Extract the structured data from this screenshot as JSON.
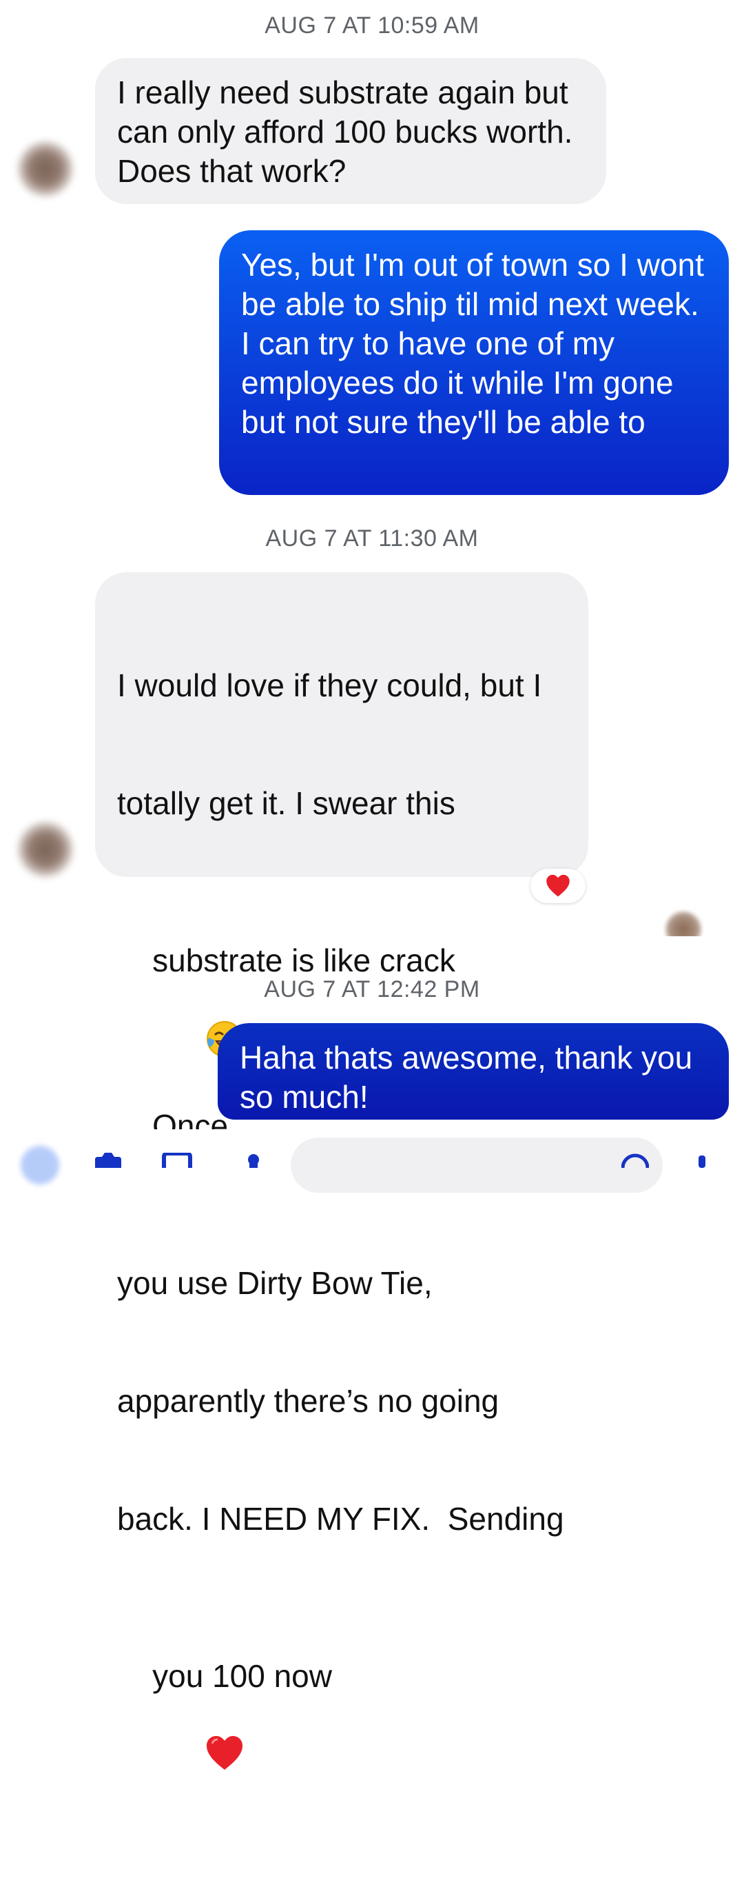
{
  "conversation": {
    "messages": [
      {
        "type": "timestamp",
        "text": "AUG 7 AT 10:59 AM"
      },
      {
        "type": "received",
        "text": "I really need substrate again but can only afford 100 bucks worth. Does that work?"
      },
      {
        "type": "sent",
        "text": "Yes, but I'm out of town so I wont be able to ship til mid next week. I can try to have one of my employees do it while I'm gone but not sure they'll be able to"
      },
      {
        "type": "timestamp",
        "text": "AUG 7 AT 11:30 AM"
      },
      {
        "type": "received",
        "lines": [
          "I would love if they could, but I",
          "totally get it. I swear this",
          "substrate is like crack",
          "Once",
          "you use Dirty Bow Tie,",
          "apparently there’s no going",
          "back. I NEED MY FIX.  Sending",
          "you 100 now"
        ],
        "emojis": [
          "face-with-tears-of-joy",
          "red-heart"
        ],
        "reaction": "red-heart"
      },
      {
        "type": "timestamp",
        "text": "AUG 7 AT 12:42 PM"
      },
      {
        "type": "sent",
        "text": "Haha thats awesome, thank you so much!"
      }
    ]
  },
  "colors": {
    "received_bubble": "#f0f0f2",
    "sent_gradient_top": "#0a5ff0",
    "sent_gradient_bottom": "#0a22c8",
    "sent_gradient_bottom_late": "#0a10a8",
    "timestamp_text": "#5f6368"
  },
  "icons": [
    "avatar",
    "heart-reaction-icon",
    "camera-icon",
    "image-icon",
    "mic-icon",
    "emoji-icon"
  ]
}
